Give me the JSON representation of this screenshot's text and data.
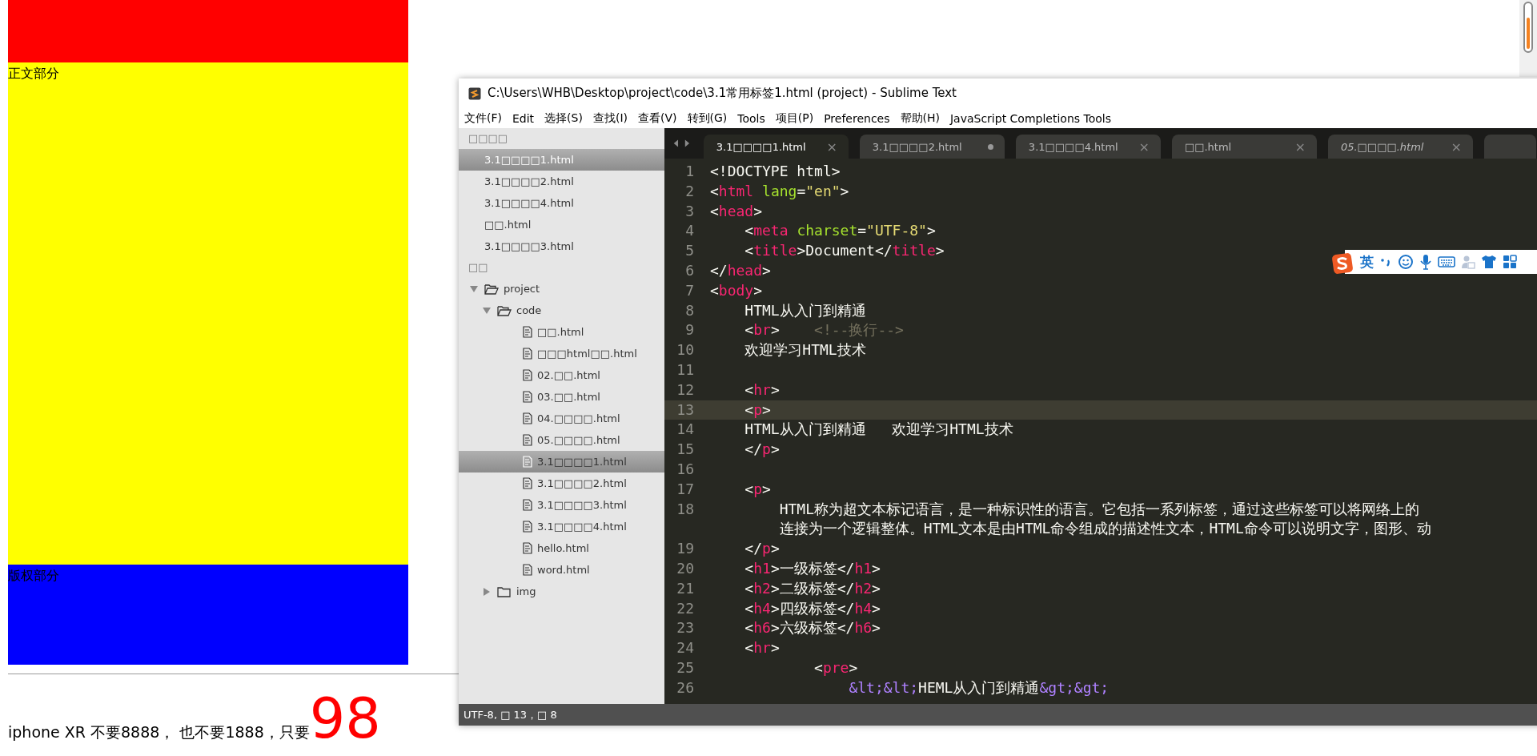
{
  "page": {
    "body_label": "正文部分",
    "footer_label": "版权部分",
    "promo_text": "iphone XR 不要8888， 也不要1888，只要",
    "price": "98"
  },
  "editor_window": {
    "title": "C:\\Users\\WHB\\Desktop\\project\\code\\3.1常用标签1.html (project) - Sublime Text",
    "menu": [
      "文件(F)",
      "Edit",
      "选择(S)",
      "查找(I)",
      "查看(V)",
      "转到(G)",
      "Tools",
      "项目(P)",
      "Preferences",
      "帮助(H)",
      "JavaScript Completions Tools"
    ],
    "sidebar": {
      "open_files_header": "□□□□",
      "open_files": [
        {
          "label": "3.1□□□□1.html",
          "selected": true
        },
        {
          "label": "3.1□□□□2.html",
          "selected": false
        },
        {
          "label": "3.1□□□□4.html",
          "selected": false
        },
        {
          "label": "□□.html",
          "selected": false
        },
        {
          "label": "3.1□□□□3.html",
          "selected": false
        }
      ],
      "folders_header": "□□",
      "tree": [
        {
          "kind": "folder",
          "label": "project",
          "expanded": true,
          "children": [
            {
              "kind": "folder",
              "label": "code",
              "expanded": true,
              "children": [
                {
                  "kind": "file",
                  "label": "□□.html",
                  "selected": false
                },
                {
                  "kind": "file",
                  "label": "□□□html□□.html",
                  "selected": false
                },
                {
                  "kind": "file",
                  "label": "02.□□.html",
                  "selected": false
                },
                {
                  "kind": "file",
                  "label": "03.□□.html",
                  "selected": false
                },
                {
                  "kind": "file",
                  "label": "04.□□□□.html",
                  "selected": false
                },
                {
                  "kind": "file",
                  "label": "05.□□□□.html",
                  "selected": false
                },
                {
                  "kind": "file",
                  "label": "3.1□□□□1.html",
                  "selected": true
                },
                {
                  "kind": "file",
                  "label": "3.1□□□□2.html",
                  "selected": false
                },
                {
                  "kind": "file",
                  "label": "3.1□□□□3.html",
                  "selected": false
                },
                {
                  "kind": "file",
                  "label": "3.1□□□□4.html",
                  "selected": false
                },
                {
                  "kind": "file",
                  "label": "hello.html",
                  "selected": false
                },
                {
                  "kind": "file",
                  "label": "word.html",
                  "selected": false
                }
              ]
            },
            {
              "kind": "folder",
              "label": "img",
              "expanded": false
            }
          ]
        }
      ]
    },
    "tabs": [
      {
        "label": "3.1□□□□1.html",
        "selected": true,
        "modified": false,
        "transient": false
      },
      {
        "label": "3.1□□□□2.html",
        "selected": false,
        "modified": true,
        "transient": false
      },
      {
        "label": "3.1□□□□4.html",
        "selected": false,
        "modified": false,
        "transient": false
      },
      {
        "label": "□□.html",
        "selected": false,
        "modified": false,
        "transient": false
      },
      {
        "label": "05.□□□□.html",
        "selected": false,
        "modified": false,
        "transient": true
      }
    ],
    "close_glyph": "×",
    "code": [
      {
        "number": "1",
        "tokens": [
          {
            "kind": "punct",
            "text": "<!DOCTYPE html>"
          }
        ]
      },
      {
        "number": "2",
        "tokens": [
          {
            "kind": "punct",
            "text": "<"
          },
          {
            "kind": "tag",
            "text": "html"
          },
          {
            "kind": "attr",
            "text": " lang"
          },
          {
            "kind": "punct",
            "text": "="
          },
          {
            "kind": "string",
            "text": "\"en\""
          },
          {
            "kind": "punct",
            "text": ">"
          }
        ]
      },
      {
        "number": "3",
        "tokens": [
          {
            "kind": "punct",
            "text": "<"
          },
          {
            "kind": "tag",
            "text": "head"
          },
          {
            "kind": "punct",
            "text": ">"
          }
        ]
      },
      {
        "number": "4",
        "tokens": [
          {
            "kind": "punct",
            "text": "    <"
          },
          {
            "kind": "tag",
            "text": "meta"
          },
          {
            "kind": "attr",
            "text": " charset"
          },
          {
            "kind": "punct",
            "text": "="
          },
          {
            "kind": "string",
            "text": "\"UTF-8\""
          },
          {
            "kind": "punct",
            "text": ">"
          }
        ]
      },
      {
        "number": "5",
        "tokens": [
          {
            "kind": "punct",
            "text": "    <"
          },
          {
            "kind": "tag",
            "text": "title"
          },
          {
            "kind": "punct",
            "text": ">Document</"
          },
          {
            "kind": "tag",
            "text": "title"
          },
          {
            "kind": "punct",
            "text": ">"
          }
        ]
      },
      {
        "number": "6",
        "tokens": [
          {
            "kind": "punct",
            "text": "</"
          },
          {
            "kind": "tag",
            "text": "head"
          },
          {
            "kind": "punct",
            "text": ">"
          }
        ]
      },
      {
        "number": "7",
        "tokens": [
          {
            "kind": "punct",
            "text": "<"
          },
          {
            "kind": "tag",
            "text": "body"
          },
          {
            "kind": "punct",
            "text": ">"
          }
        ]
      },
      {
        "number": "8",
        "tokens": [
          {
            "kind": "punct",
            "text": "    HTML从入门到精通"
          }
        ]
      },
      {
        "number": "9",
        "tokens": [
          {
            "kind": "punct",
            "text": "    <"
          },
          {
            "kind": "tag",
            "text": "br"
          },
          {
            "kind": "punct",
            "text": ">    "
          },
          {
            "kind": "comment",
            "text": "<!--换行-->"
          }
        ]
      },
      {
        "number": "10",
        "tokens": [
          {
            "kind": "punct",
            "text": "    欢迎学习HTML技术"
          }
        ]
      },
      {
        "number": "11"
      },
      {
        "number": "12",
        "tokens": [
          {
            "kind": "punct",
            "text": "    <"
          },
          {
            "kind": "tag",
            "text": "hr"
          },
          {
            "kind": "punct",
            "text": ">"
          }
        ]
      },
      {
        "number": "13",
        "current": true,
        "tokens": [
          {
            "kind": "punct",
            "text": "    <"
          },
          {
            "kind": "tag",
            "text": "p"
          },
          {
            "kind": "punct",
            "text": ">"
          }
        ]
      },
      {
        "number": "14",
        "tokens": [
          {
            "kind": "punct",
            "text": "    HTML从入门到精通   欢迎学习HTML技术"
          }
        ]
      },
      {
        "number": "15",
        "tokens": [
          {
            "kind": "punct",
            "text": "    </"
          },
          {
            "kind": "tag",
            "text": "p"
          },
          {
            "kind": "punct",
            "text": ">"
          }
        ]
      },
      {
        "number": "16"
      },
      {
        "number": "17",
        "tokens": [
          {
            "kind": "punct",
            "text": "    <"
          },
          {
            "kind": "tag",
            "text": "p"
          },
          {
            "kind": "punct",
            "text": ">"
          }
        ]
      },
      {
        "number": "18",
        "tokens": [
          {
            "kind": "punct",
            "text": "        HTML称为超文本标记语言，是一种标识性的语言。它包括一系列标签，通过这些标签可以将网络上的"
          }
        ]
      },
      {
        "tokens": [
          {
            "kind": "punct",
            "text": "        连接为一个逻辑整体。HTML文本是由HTML命令组成的描述性文本，HTML命令可以说明文字，图形、动"
          }
        ]
      },
      {
        "number": "19",
        "tokens": [
          {
            "kind": "punct",
            "text": "    </"
          },
          {
            "kind": "tag",
            "text": "p"
          },
          {
            "kind": "punct",
            "text": ">"
          }
        ]
      },
      {
        "number": "20",
        "tokens": [
          {
            "kind": "punct",
            "text": "    <"
          },
          {
            "kind": "tag",
            "text": "h1"
          },
          {
            "kind": "punct",
            "text": ">一级标签</"
          },
          {
            "kind": "tag",
            "text": "h1"
          },
          {
            "kind": "punct",
            "text": ">"
          }
        ]
      },
      {
        "number": "21",
        "tokens": [
          {
            "kind": "punct",
            "text": "    <"
          },
          {
            "kind": "tag",
            "text": "h2"
          },
          {
            "kind": "punct",
            "text": ">二级标签</"
          },
          {
            "kind": "tag",
            "text": "h2"
          },
          {
            "kind": "punct",
            "text": ">"
          }
        ]
      },
      {
        "number": "22",
        "tokens": [
          {
            "kind": "punct",
            "text": "    <"
          },
          {
            "kind": "tag",
            "text": "h4"
          },
          {
            "kind": "punct",
            "text": ">四级标签</"
          },
          {
            "kind": "tag",
            "text": "h4"
          },
          {
            "kind": "punct",
            "text": ">"
          }
        ]
      },
      {
        "number": "23",
        "tokens": [
          {
            "kind": "punct",
            "text": "    <"
          },
          {
            "kind": "tag",
            "text": "h6"
          },
          {
            "kind": "punct",
            "text": ">六级标签</"
          },
          {
            "kind": "tag",
            "text": "h6"
          },
          {
            "kind": "punct",
            "text": ">"
          }
        ]
      },
      {
        "number": "24",
        "tokens": [
          {
            "kind": "punct",
            "text": "    <"
          },
          {
            "kind": "tag",
            "text": "hr"
          },
          {
            "kind": "punct",
            "text": ">"
          }
        ]
      },
      {
        "number": "25",
        "tokens": [
          {
            "kind": "punct",
            "text": "            <"
          },
          {
            "kind": "tag",
            "text": "pre"
          },
          {
            "kind": "punct",
            "text": ">"
          }
        ]
      },
      {
        "number": "26",
        "tokens": [
          {
            "kind": "entity",
            "text": "                &lt;&lt;"
          },
          {
            "kind": "punct",
            "text": "HEML从入门到精通"
          },
          {
            "kind": "entity",
            "text": "&gt;&gt;"
          }
        ]
      }
    ],
    "status_bar": "UTF-8, □ 13，□ 8"
  },
  "ime_toolbar": {
    "mode": "英"
  }
}
